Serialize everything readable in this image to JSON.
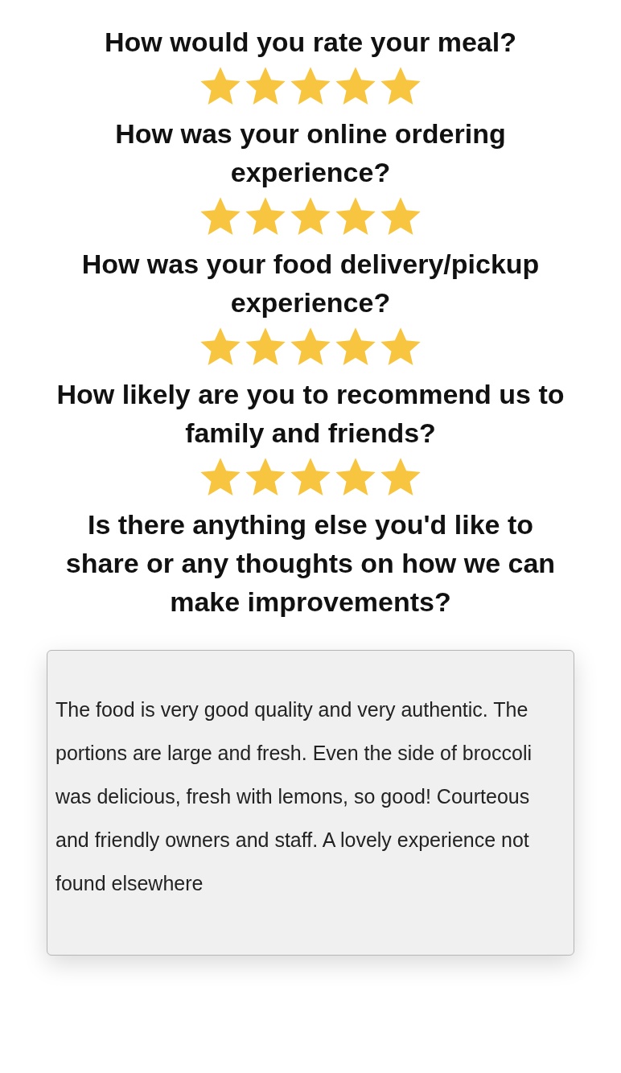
{
  "questions": [
    {
      "kind": "rating",
      "question": "How would you rate your meal?",
      "stars": 5
    },
    {
      "kind": "rating",
      "question": "How was your online ordering experience?",
      "stars": 5
    },
    {
      "kind": "rating",
      "question": "How was your food delivery/pickup experience?",
      "stars": 5
    },
    {
      "kind": "rating",
      "question": "How likely are you to recommend us to family and friends?",
      "stars": 5
    },
    {
      "kind": "text",
      "question": "Is there anything else you'd like to share or any thoughts on how we can make improvements?",
      "value": "The food is very good quality and very authentic. The portions are large and fresh. Even the side of broccoli was delicious, fresh with lemons, so good! Courteous and friendly owners and staff. A lovely experience not found elsewhere"
    }
  ]
}
